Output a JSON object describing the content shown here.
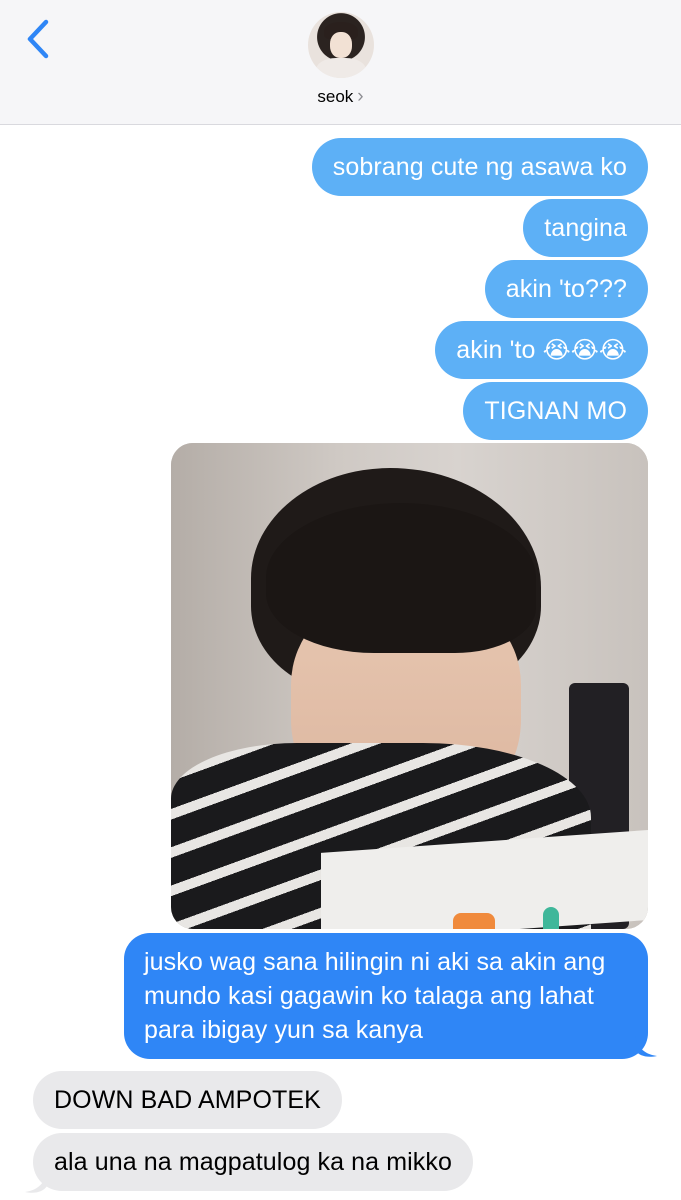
{
  "header": {
    "contact_name": "seok",
    "chevron": "›",
    "back_icon": "chevron-left-icon"
  },
  "messages": [
    {
      "type": "outgoing",
      "text": "sobrang cute ng asawa ko"
    },
    {
      "type": "outgoing",
      "text": "tangina"
    },
    {
      "type": "outgoing",
      "text": "akin 'to???"
    },
    {
      "type": "outgoing",
      "text": "akin 'to",
      "emoji": "😭😭😭"
    },
    {
      "type": "outgoing",
      "text": "TIGNAN MO"
    },
    {
      "type": "outgoing-image",
      "image": "photo-of-person"
    },
    {
      "type": "outgoing",
      "text": "jusko wag sana hilingin ni aki sa akin ang mundo kasi gagawin ko talaga ang lahat para ibigay yun sa kanya"
    },
    {
      "type": "incoming",
      "text": "DOWN BAD AMPOTEK"
    },
    {
      "type": "incoming",
      "text": "ala una na magpatulog ka na mikko"
    }
  ],
  "colors": {
    "outgoing_light": "#5db0f6",
    "outgoing_dark": "#2f86f6",
    "incoming": "#e9e9eb",
    "back_chevron": "#2f86f6"
  }
}
